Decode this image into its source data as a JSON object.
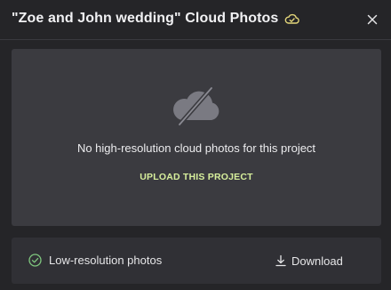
{
  "dialog": {
    "title": "\"Zoe and John wedding\" Cloud Photos",
    "title_icon": "cloud-sync-icon",
    "close_icon": "close-icon"
  },
  "empty_state": {
    "icon": "cloud-off-icon",
    "message": "No high-resolution cloud photos for this project",
    "action_label": "UPLOAD THIS PROJECT"
  },
  "footer": {
    "status_icon": "check-circle-icon",
    "status_label": "Low-resolution photos",
    "download_icon": "download-icon",
    "download_label": "Download"
  },
  "colors": {
    "background": "#252528",
    "panel": "#3b3b40",
    "footer_panel": "#303035",
    "accent_yellow": "#e4d67a",
    "accent_green": "#7fc77f",
    "upload_link": "#d7ef9c"
  }
}
